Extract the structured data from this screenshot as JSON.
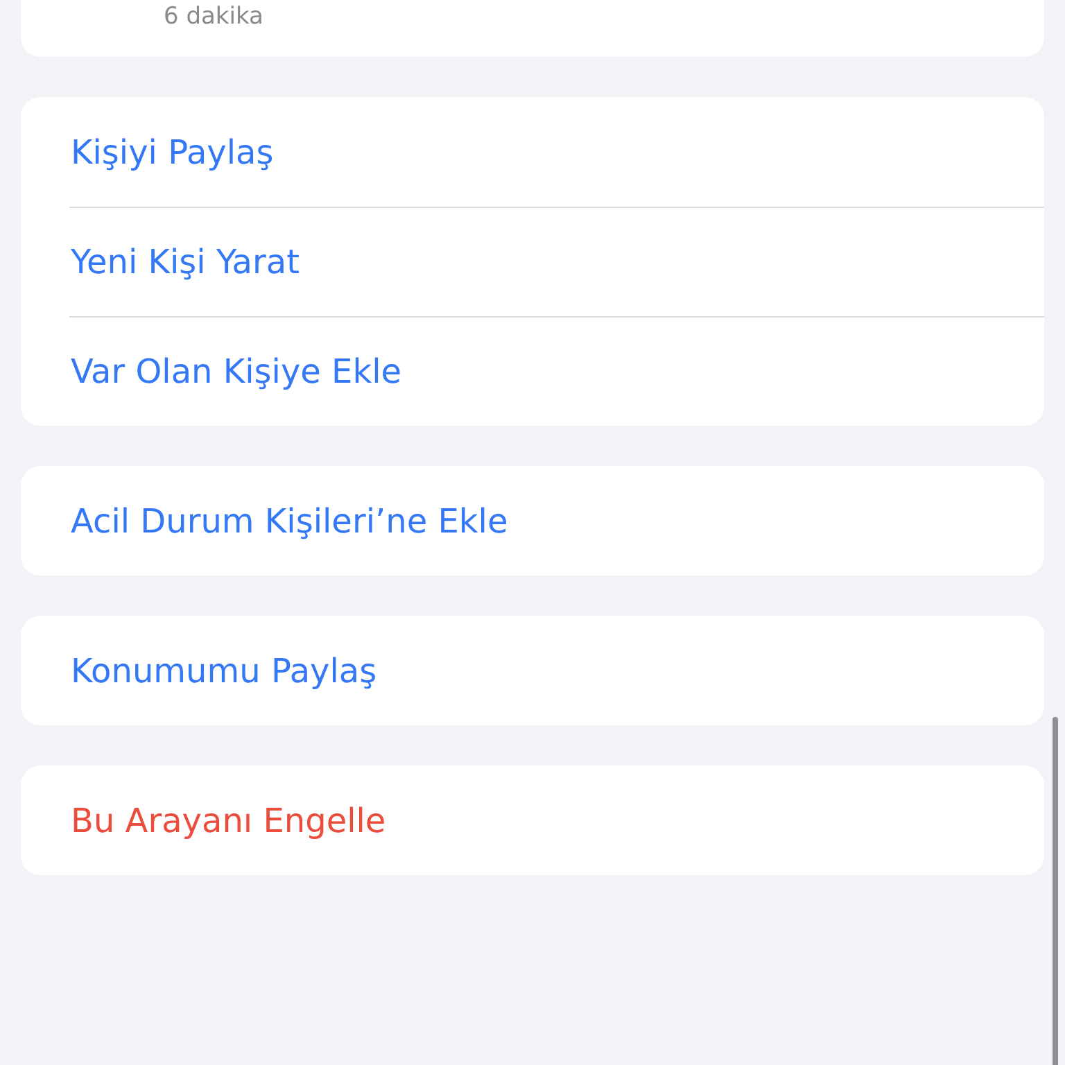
{
  "top_card": {
    "subtitle": "6 dakika"
  },
  "groups": [
    {
      "items": [
        {
          "label": "Kişiyi Paylaş",
          "kind": "action"
        },
        {
          "label": "Yeni Kişi Yarat",
          "kind": "action"
        },
        {
          "label": "Var Olan Kişiye Ekle",
          "kind": "action"
        }
      ]
    },
    {
      "items": [
        {
          "label": "Acil Durum Kişileri’ne Ekle",
          "kind": "action"
        }
      ]
    },
    {
      "items": [
        {
          "label": "Konumumu Paylaş",
          "kind": "action"
        }
      ]
    },
    {
      "items": [
        {
          "label": "Bu Arayanı Engelle",
          "kind": "destructive"
        }
      ]
    }
  ]
}
